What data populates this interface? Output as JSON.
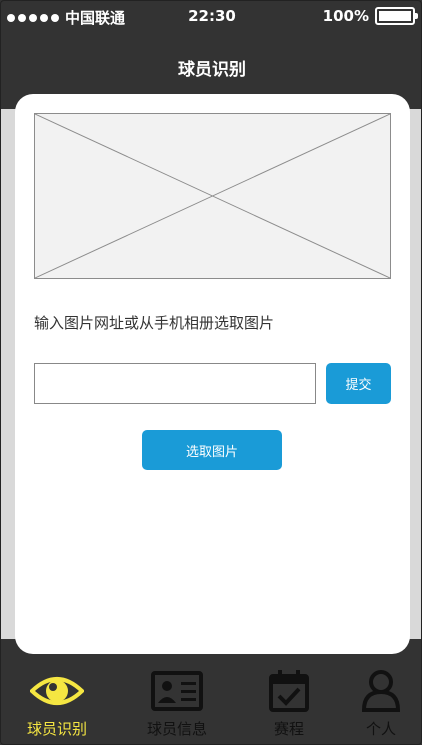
{
  "status_bar": {
    "carrier": "中国联通",
    "time": "22:30",
    "battery": "100%"
  },
  "header": {
    "title": "球员识别"
  },
  "main": {
    "hint": "输入图片网址或从手机相册选取图片",
    "url_input": {
      "value": "",
      "placeholder": ""
    },
    "submit_label": "提交",
    "pick_label": "选取图片"
  },
  "tabbar": {
    "tabs": [
      {
        "label": "球员识别",
        "icon": "eye-icon"
      },
      {
        "label": "球员信息",
        "icon": "id-card-icon"
      },
      {
        "label": "赛程",
        "icon": "calendar-check-icon"
      },
      {
        "label": "个人",
        "icon": "user-icon"
      }
    ]
  },
  "colors": {
    "accent": "#1a9bd7",
    "active_tab": "#f5e642",
    "bar_background": "#333333"
  }
}
